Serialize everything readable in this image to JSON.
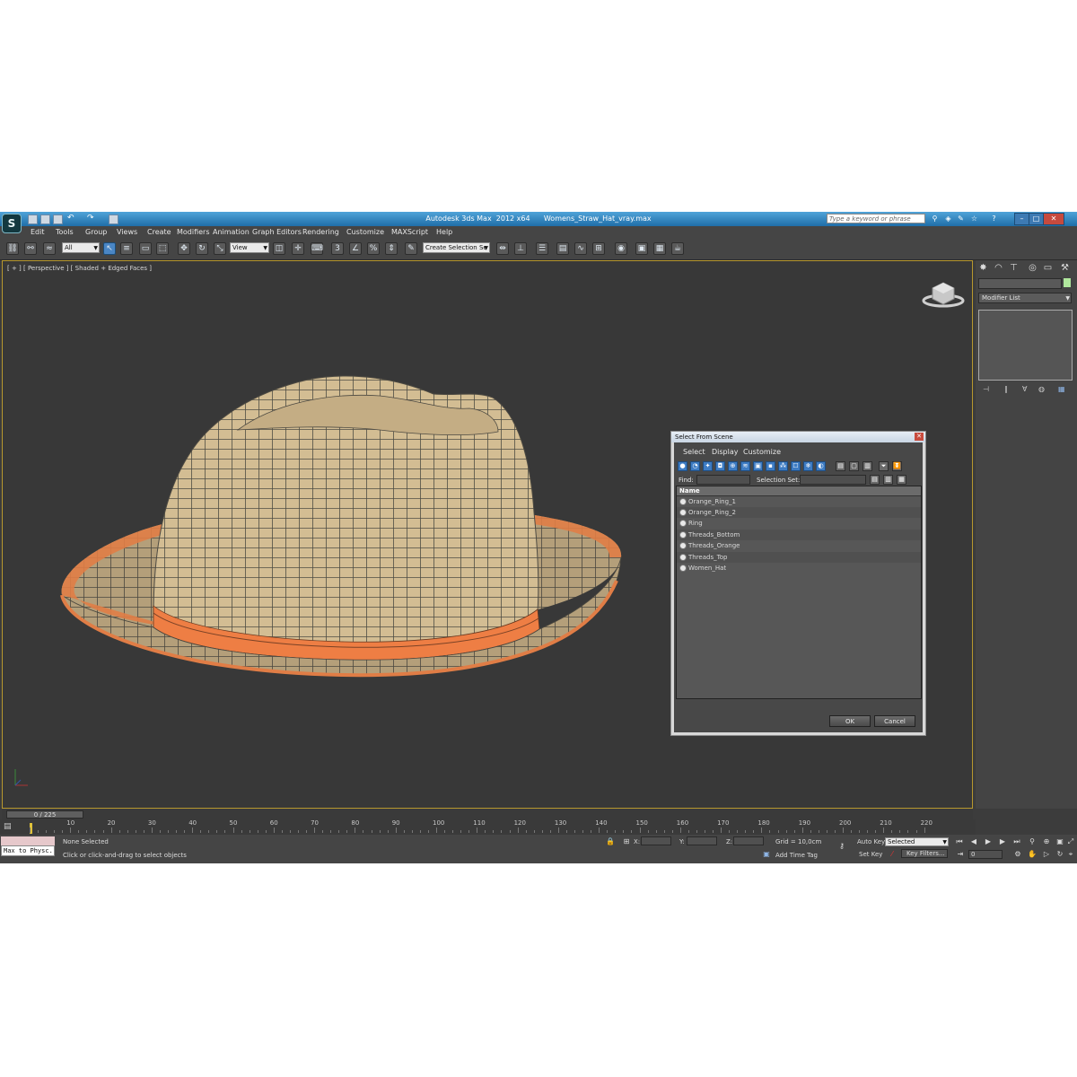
{
  "window": {
    "title": "Autodesk 3ds Max  2012 x64      Womens_Straw_Hat_vray.max",
    "search_placeholder": "Type a keyword or phrase"
  },
  "menu": [
    "Edit",
    "Tools",
    "Group",
    "Views",
    "Create",
    "Modifiers",
    "Animation",
    "Graph Editors",
    "Rendering",
    "Customize",
    "MAXScript",
    "Help"
  ],
  "toolbar": {
    "filter_value": "All",
    "ref_coord_value": "View",
    "selection_set_value": "Create Selection Se"
  },
  "viewport": {
    "label": "[ + ] [ Perspective ] [ Shaded + Edged Faces ]"
  },
  "command_panel": {
    "modifier_list": "Modifier List",
    "object_color": "#b0e89d"
  },
  "dialog": {
    "title": "Select From Scene",
    "menus": [
      "Select",
      "Display",
      "Customize"
    ],
    "find_label": "Find:",
    "selection_set_label": "Selection Set:",
    "column_header": "Name",
    "objects": [
      "Orange_Ring_1",
      "Orange_Ring_2",
      "Ring",
      "Threads_Bottom",
      "Threads_Orange",
      "Threads_Top",
      "Women_Hat"
    ],
    "ok_label": "OK",
    "cancel_label": "Cancel"
  },
  "timeline": {
    "frame_display": "0 / 225",
    "ticks": [
      "0",
      "10",
      "20",
      "30",
      "40",
      "50",
      "60",
      "70",
      "80",
      "90",
      "100",
      "110",
      "120",
      "130",
      "140",
      "150",
      "160",
      "170",
      "180",
      "190",
      "200",
      "210",
      "220"
    ]
  },
  "status": {
    "maxscript_listener": "Max to Physc.",
    "selection_status": "None Selected",
    "prompt": "Click or click-and-drag to select objects",
    "x_label": "X:",
    "y_label": "Y:",
    "z_label": "Z:",
    "grid": "Grid = 10,0cm",
    "add_time_tag": "Add Time Tag",
    "auto_key": "Auto Key",
    "set_key": "Set Key",
    "key_mode_value": "Selected",
    "key_filters": "Key Filters...",
    "current_frame": "0"
  }
}
